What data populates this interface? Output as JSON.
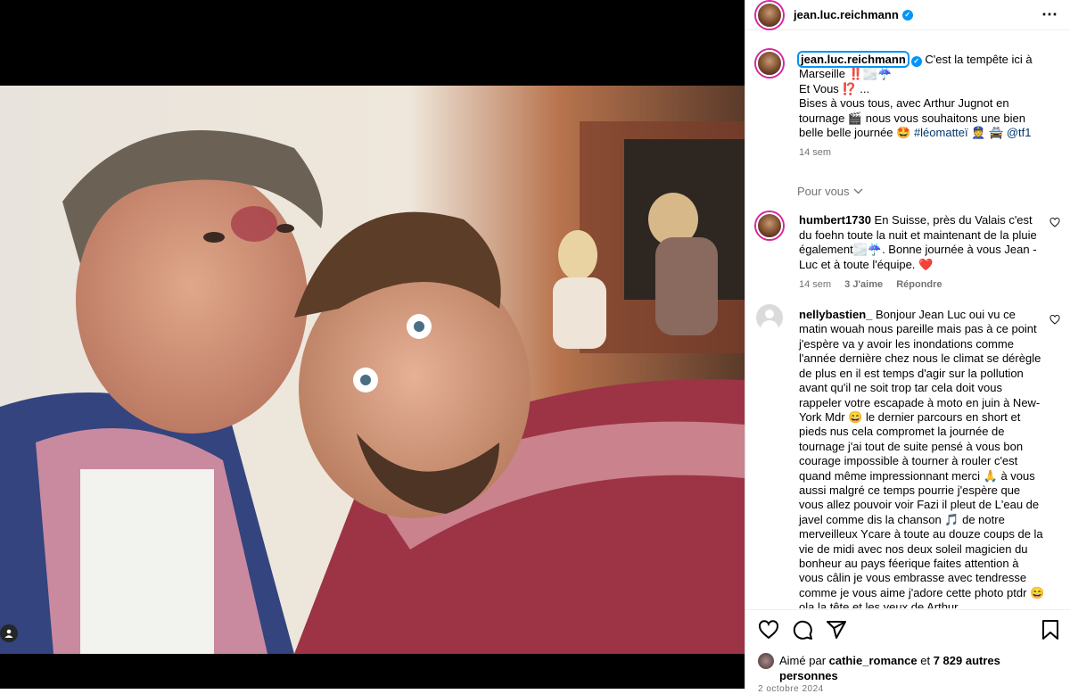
{
  "post": {
    "author": "jean.luc.reichmann",
    "caption": {
      "author": "jean.luc.reichmann",
      "line1": "C'est la tempête ici à Marseille ‼️🌫️☔",
      "line2": "Et Vous ⁉️ ...",
      "line3": "Bises à vous tous, avec Arthur Jugnot en tournage 🎬 nous vous souhaitons une bien belle belle journée 🤩 ",
      "hashtag": "#léomatteï",
      "emoji_after": " 👮 🚔 ",
      "mention": "@tf1",
      "time": "14 sem"
    },
    "pour_vous": "Pour vous"
  },
  "comments": [
    {
      "user": "humbert1730",
      "text": "En Suisse, près du Valais c'est du foehn toute la nuit et maintenant de la pluie également🌫️☔. Bonne journée à vous Jean - Luc et à toute l'équipe. ❤️",
      "time": "14 sem",
      "likes": "3 J'aime",
      "reply": "Répondre"
    },
    {
      "user": "nellybastien_",
      "text": "Bonjour Jean Luc oui vu ce matin wouah nous pareille mais pas à ce point j'espère va y avoir les inondations comme l'année dernière chez nous le climat se dérègle de plus en il est temps d'agir sur la pollution avant qu'il ne soit trop tar cela doit vous rappeler votre escapade à moto en juin à New-York Mdr 😄 le dernier parcours en short et pieds nus cela compromet la journée de tournage j'ai tout de suite pensé à vous bon courage impossible à tourner à rouler c'est quand même impressionnant merci 🙏 à vous aussi malgré ce temps pourrie j'espère que vous allez pouvoir voir Fazi il pleut de L'eau de javel comme dis la chanson 🎵 de notre merveilleux Ycare à toute au douze coups de la vie de midi avec nos deux soleil magicien du bonheur au pays féerique faites attention à vous câlin je vous embrasse avec tendresse comme je vous aime j'adore cette photo ptdr 😄 ola la tête et les yeux de Arthur"
    }
  ],
  "likes_line": {
    "prefix": "Aimé par ",
    "user": "cathie_romance",
    "middle": " et ",
    "count": "7 829 autres personnes"
  },
  "date": "2 octobre 2024",
  "icons": [
    "more-horizontal-icon",
    "verified-icon",
    "heart-icon",
    "comment-icon",
    "share-icon",
    "bookmark-icon",
    "chevron-down-icon",
    "tag-user-icon"
  ],
  "colors": {
    "verified": "#0095f6",
    "muted": "#737373",
    "link": "#00376b"
  }
}
